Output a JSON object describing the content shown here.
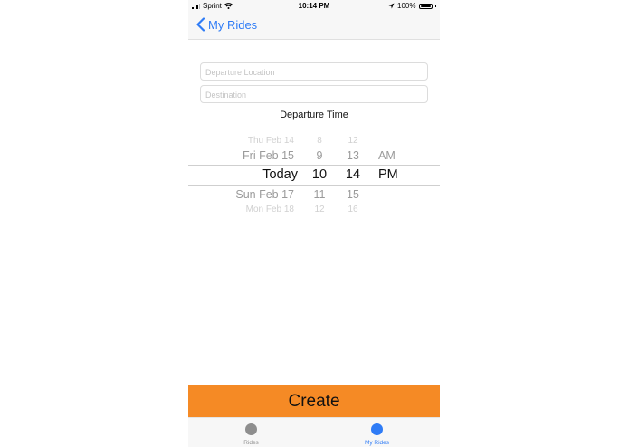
{
  "status_bar": {
    "carrier": "Sprint",
    "time": "10:14 PM",
    "battery": "100%"
  },
  "nav": {
    "back_label": "My Rides"
  },
  "form": {
    "departure_placeholder": "Departure Location",
    "departure_value": "",
    "destination_placeholder": "Destination",
    "destination_value": "",
    "departure_time_label": "Departure Time"
  },
  "picker": {
    "rows": [
      {
        "day": "Thu Feb 14",
        "hour": "8",
        "minute": "12",
        "period": ""
      },
      {
        "day": "Fri Feb 15",
        "hour": "9",
        "minute": "13",
        "period": "AM"
      },
      {
        "day": "Today",
        "hour": "10",
        "minute": "14",
        "period": "PM"
      },
      {
        "day": "Sun Feb 17",
        "hour": "11",
        "minute": "15",
        "period": ""
      },
      {
        "day": "Mon Feb 18",
        "hour": "12",
        "minute": "16",
        "period": ""
      }
    ]
  },
  "create_label": "Create",
  "tabs": [
    {
      "label": "Rides",
      "icon": "circle-icon",
      "color": "#8e8e8e",
      "active": false
    },
    {
      "label": "My Rides",
      "icon": "circle-icon",
      "color": "#2f7cf6",
      "active": true
    }
  ],
  "colors": {
    "accent": "#2f7cf6",
    "create": "#f58a25"
  }
}
